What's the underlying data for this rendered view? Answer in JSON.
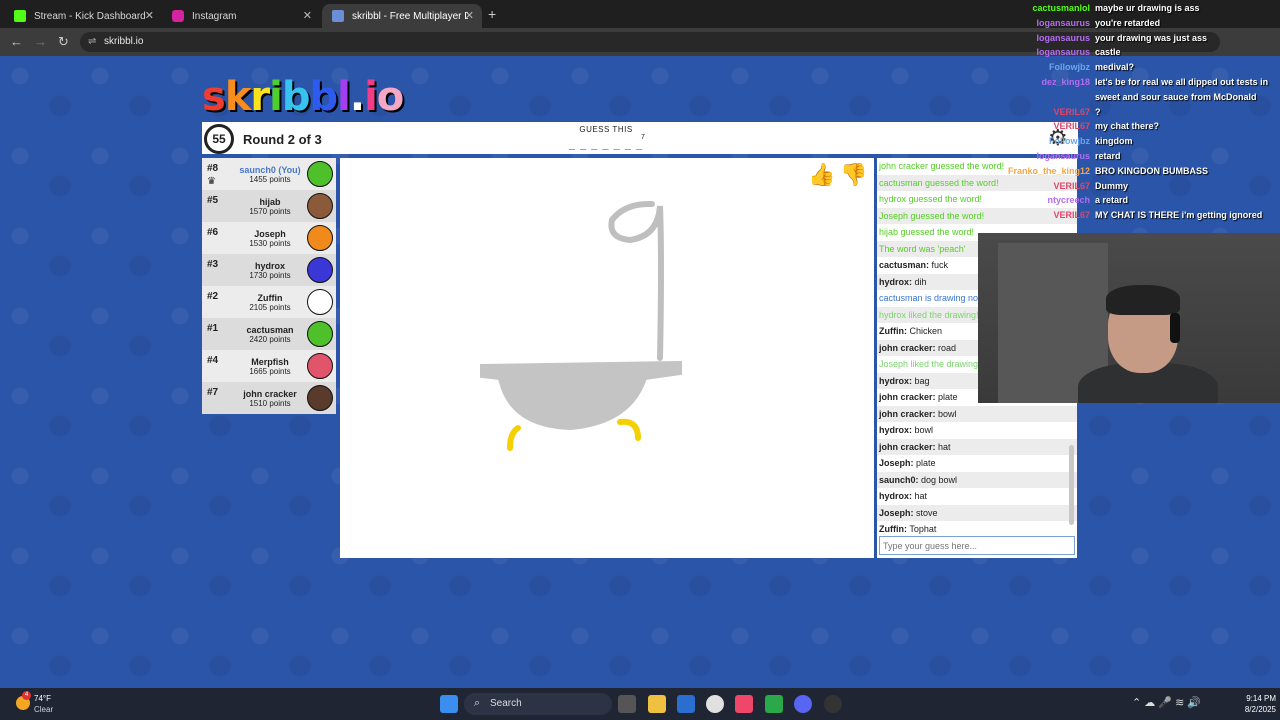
{
  "browser": {
    "tabs": [
      {
        "title": "Stream - Kick Dashboard",
        "color": "#53fc18",
        "glyph": "K"
      },
      {
        "title": "Instagram",
        "color": "#d6249f",
        "glyph": "◎"
      },
      {
        "title": "skribbl - Free Multiplayer Drawi",
        "color": "#6b8fd6",
        "glyph": "✎"
      }
    ],
    "close_glyph": "✕",
    "new_tab_glyph": "+",
    "url": "skribbl.io",
    "back_glyph": "←",
    "forward_glyph": "→",
    "reload_glyph": "↻",
    "site_icon_glyph": "⇌"
  },
  "game": {
    "logo_letters": [
      "s",
      "k",
      "r",
      "i",
      "b",
      "b",
      "l",
      ".",
      "i",
      "o"
    ],
    "logo_colors": [
      "#ef3d2f",
      "#f98c1b",
      "#fce11d",
      "#4ed02a",
      "#37c3ef",
      "#2d5bef",
      "#a53ef0",
      ".#ffffff",
      "#ef3d8a",
      "#f4a8c6"
    ],
    "timer": "55",
    "round": "Round 2 of 3",
    "guess_label": "GUESS THIS",
    "hint": "_ _ _ _ _ _ _",
    "hint_count": "7",
    "gear_glyph": "⚙",
    "like_glyph": "👍",
    "dislike_glyph": "👎",
    "crown_glyph": "♛",
    "players": [
      {
        "rank": "#8",
        "name": "saunch0 (You)",
        "points": "1455 points",
        "color": "#4ec12a",
        "you": true
      },
      {
        "rank": "#5",
        "name": "hijab",
        "points": "1570 points",
        "color": "#8a5a3a",
        "you": false
      },
      {
        "rank": "#6",
        "name": "Joseph",
        "points": "1530 points",
        "color": "#f08a1c",
        "you": false
      },
      {
        "rank": "#3",
        "name": "hydrox",
        "points": "1730 points",
        "color": "#3a37d6",
        "you": false
      },
      {
        "rank": "#2",
        "name": "Zuffin",
        "points": "2105 points",
        "color": "#ffffff",
        "you": false
      },
      {
        "rank": "#1",
        "name": "cactusman",
        "points": "2420 points",
        "color": "#4ec12a",
        "you": false
      },
      {
        "rank": "#4",
        "name": "Merpfish",
        "points": "1665 points",
        "color": "#e0556a",
        "you": false
      },
      {
        "rank": "#7",
        "name": "john cracker",
        "points": "1510 points",
        "color": "#5a3a2a",
        "you": false
      }
    ],
    "chat": [
      {
        "style": "green",
        "user": "",
        "text": "john cracker guessed the word!"
      },
      {
        "style": "green",
        "user": "",
        "text": "cactusman guessed the word!"
      },
      {
        "style": "green",
        "user": "",
        "text": "hydrox guessed the word!"
      },
      {
        "style": "green",
        "user": "",
        "text": "Joseph guessed the word!"
      },
      {
        "style": "green",
        "user": "",
        "text": "hijab guessed the word!"
      },
      {
        "style": "green",
        "user": "",
        "text": "The word was 'peach'"
      },
      {
        "style": "",
        "user": "cactusman:",
        "text": " fuck"
      },
      {
        "style": "",
        "user": "hydrox:",
        "text": " dih"
      },
      {
        "style": "blue",
        "user": "",
        "text": "cactusman is drawing now!"
      },
      {
        "style": "lgreen",
        "user": "",
        "text": "hydrox liked the drawing!"
      },
      {
        "style": "",
        "user": "Zuffin:",
        "text": " Chicken"
      },
      {
        "style": "",
        "user": "john cracker:",
        "text": " road"
      },
      {
        "style": "lgreen",
        "user": "",
        "text": "Joseph liked the drawing!"
      },
      {
        "style": "",
        "user": "hydrox:",
        "text": " bag"
      },
      {
        "style": "",
        "user": "john cracker:",
        "text": " plate"
      },
      {
        "style": "",
        "user": "john cracker:",
        "text": " bowl"
      },
      {
        "style": "",
        "user": "hydrox:",
        "text": " bowl"
      },
      {
        "style": "",
        "user": "john cracker:",
        "text": " hat"
      },
      {
        "style": "",
        "user": "Joseph:",
        "text": " plate"
      },
      {
        "style": "",
        "user": "saunch0:",
        "text": " dog bowl"
      },
      {
        "style": "",
        "user": "hydrox:",
        "text": " hat"
      },
      {
        "style": "",
        "user": "Joseph:",
        "text": " stove"
      },
      {
        "style": "",
        "user": "Zuffin:",
        "text": " Tophat"
      }
    ],
    "guess_placeholder": "Type your guess here..."
  },
  "stream_chat": [
    {
      "user": "cactusmanlol",
      "color": "#53fc18",
      "text": "maybe ur drawing is ass"
    },
    {
      "user": "logansaurus",
      "color": "#b46cf0",
      "text": "you're retarded"
    },
    {
      "user": "logansaurus",
      "color": "#b46cf0",
      "text": "your drawing was just ass"
    },
    {
      "user": "logansaurus",
      "color": "#b46cf0",
      "text": "castle"
    },
    {
      "user": "Followjbz",
      "color": "#6aa6f0",
      "text": "medival?"
    },
    {
      "user": "dez_king18",
      "color": "#b46cf0",
      "text": "let's be for real we all dipped out tests in"
    },
    {
      "user": "",
      "color": "#ffffff",
      "text": "sweet and sour sauce from McDonald"
    },
    {
      "user": "VERIL67",
      "color": "#e0456a",
      "text": "?"
    },
    {
      "user": "VERIL67",
      "color": "#e0456a",
      "text": "my chat there?"
    },
    {
      "user": "Followjbz",
      "color": "#6aa6f0",
      "text": "kingdom"
    },
    {
      "user": "logansaurus",
      "color": "#b46cf0",
      "text": "retard"
    },
    {
      "user": "Franko_the_king12",
      "color": "#f0a84a",
      "text": "BRO KINGDON BUMBASS"
    },
    {
      "user": "VERIL67",
      "color": "#e0456a",
      "text": "Dummy"
    },
    {
      "user": "ntycreech",
      "color": "#b46cf0",
      "text": "a retard"
    },
    {
      "user": "VERIL67",
      "color": "#e0456a",
      "text": "MY CHAT IS THERE i'm getting ignored"
    }
  ],
  "taskbar": {
    "weather_temp": "74°F",
    "weather_desc": "Clear",
    "weather_badge": "4",
    "search_label": "Search",
    "search_glyph": "⌕",
    "tray_glyphs": "⌃  ☁  🎤  ≋  🔊",
    "time": "9:14 PM",
    "date": "8/2/2025"
  }
}
